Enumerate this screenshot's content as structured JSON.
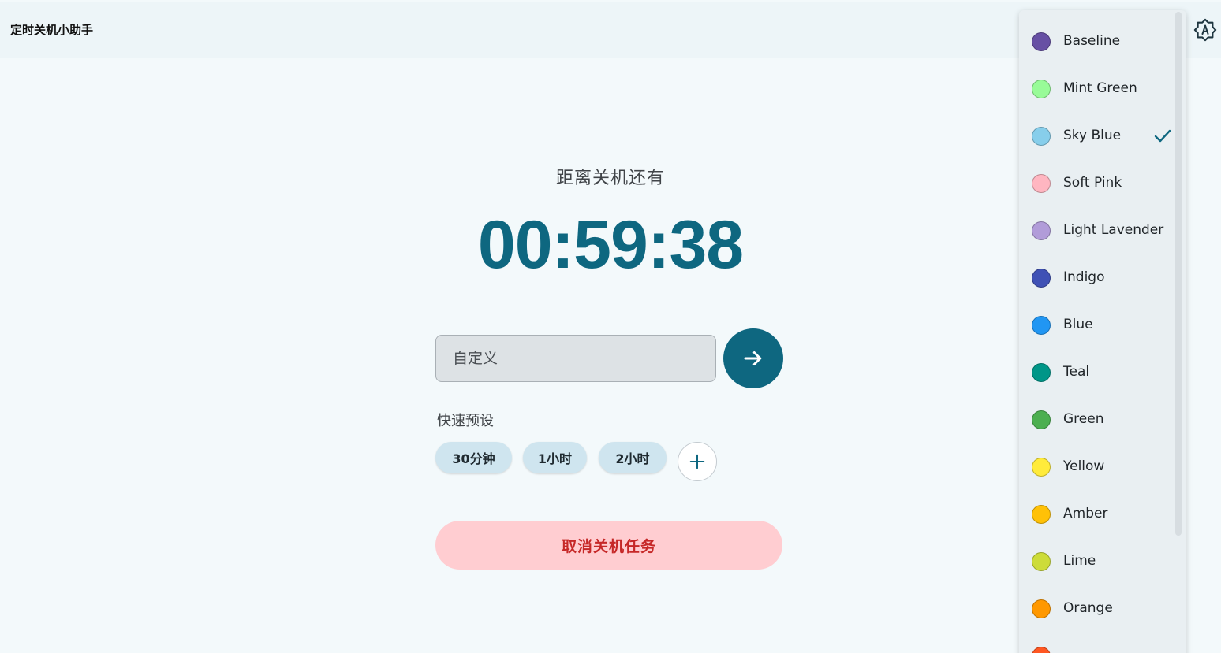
{
  "app": {
    "title": "定时关机小助手"
  },
  "countdown": {
    "label": "距离关机还有",
    "time": "00:59:38"
  },
  "custom": {
    "placeholder": "自定义"
  },
  "presets": {
    "label": "快速预设",
    "chips": [
      "30分钟",
      "1小时",
      "2小时"
    ]
  },
  "cancel": {
    "label": "取消关机任务"
  },
  "icons": {
    "theme": "brightness-auto-icon",
    "go": "arrow-right-icon",
    "add": "plus-icon",
    "selected": "check-icon"
  },
  "colors": {
    "primary": "#0e6780",
    "cancel_bg": "#ffcdd1",
    "cancel_text": "#c62828",
    "chip_bg": "#cfe5ef"
  },
  "theme_menu": {
    "selected": "Sky Blue",
    "items": [
      {
        "label": "Baseline",
        "color": "#6750a4"
      },
      {
        "label": "Mint Green",
        "color": "#98fb98"
      },
      {
        "label": "Sky Blue",
        "color": "#87ceeb"
      },
      {
        "label": "Soft Pink",
        "color": "#ffb6c1"
      },
      {
        "label": "Light Lavender",
        "color": "#b19cd9"
      },
      {
        "label": "Indigo",
        "color": "#3f51b5"
      },
      {
        "label": "Blue",
        "color": "#2196f3"
      },
      {
        "label": "Teal",
        "color": "#009688"
      },
      {
        "label": "Green",
        "color": "#4caf50"
      },
      {
        "label": "Yellow",
        "color": "#ffeb3b"
      },
      {
        "label": "Amber",
        "color": "#ffc107"
      },
      {
        "label": "Lime",
        "color": "#cddc39"
      },
      {
        "label": "Orange",
        "color": "#ff9800"
      },
      {
        "label": "",
        "color": "#ff5722"
      }
    ]
  }
}
